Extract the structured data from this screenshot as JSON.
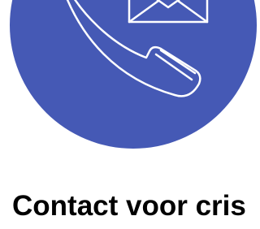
{
  "card": {
    "icon": "phone-mail-icon",
    "circle_color": "#4559B5",
    "icon_stroke_color": "#ffffff",
    "title": "Contact voor cris"
  }
}
